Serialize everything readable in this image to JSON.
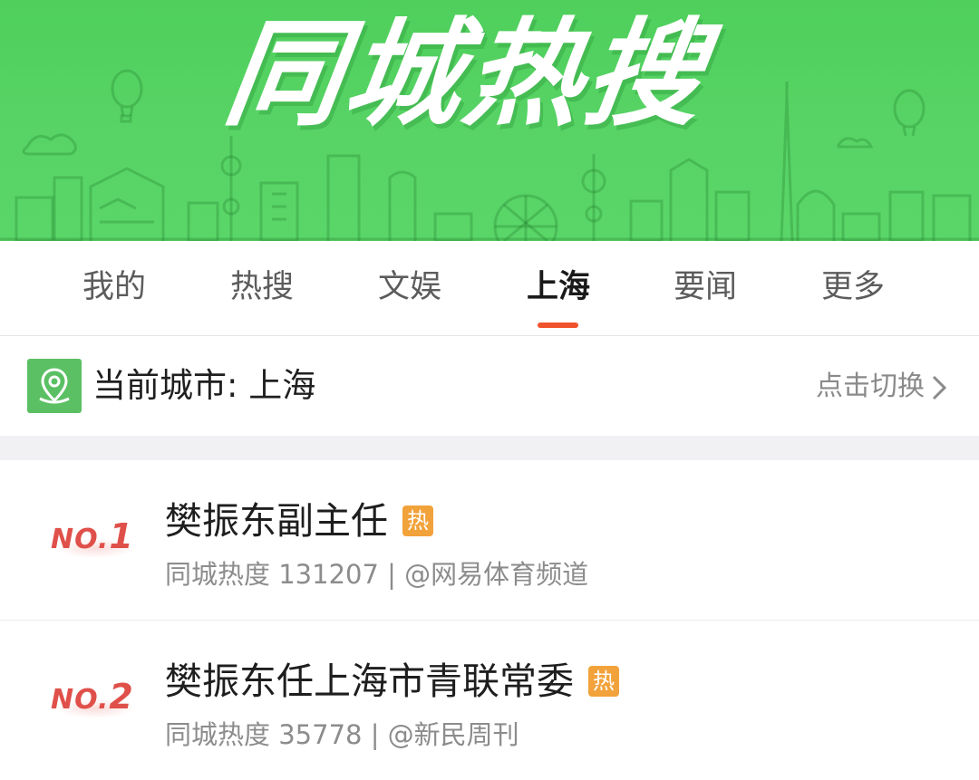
{
  "banner": {
    "title": "同城热搜",
    "bg_color": "#56d364"
  },
  "tabs": [
    {
      "label": "我的",
      "active": false
    },
    {
      "label": "热搜",
      "active": false
    },
    {
      "label": "文娱",
      "active": false
    },
    {
      "label": "上海",
      "active": true
    },
    {
      "label": "要闻",
      "active": false
    },
    {
      "label": "更多",
      "active": false
    }
  ],
  "accent_color": "#f0532c",
  "city": {
    "label": "当前城市: 上海",
    "switch_label": "点击切换",
    "icon": "location-pin-icon",
    "switch_icon": "chevron-right-icon"
  },
  "list": [
    {
      "rank_prefix": "NO.",
      "rank_number": "1",
      "title": "樊振东副主任",
      "badge": "热",
      "meta": "同城热度 131207 | @网易体育频道"
    },
    {
      "rank_prefix": "NO.",
      "rank_number": "2",
      "title": "樊振东任上海市青联常委",
      "badge": "热",
      "meta": "同城热度 35778 | @新民周刊"
    }
  ]
}
